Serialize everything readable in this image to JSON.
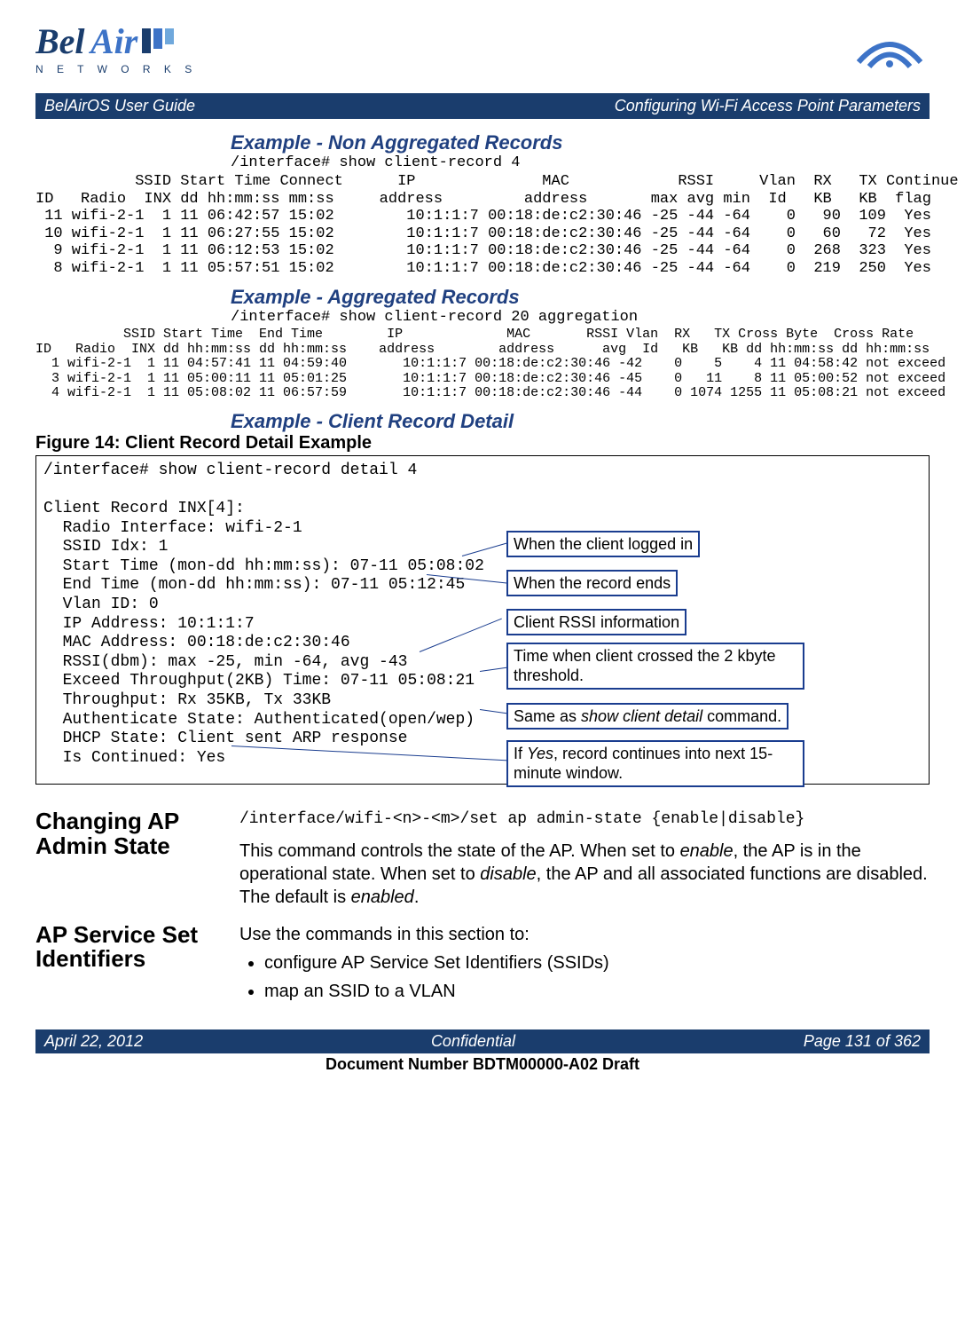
{
  "chart_data": {
    "type": "table",
    "tables": [
      {
        "name": "non_aggregated_records",
        "columns": [
          "ID",
          "Radio",
          "SSID INX",
          "Start Time dd",
          "Start Time hh:mm:ss",
          "Connect mm:ss",
          "IP address",
          "MAC address",
          "RSSI max",
          "RSSI avg",
          "RSSI min",
          "Vlan Id",
          "RX KB",
          "TX KB",
          "Continue flag"
        ],
        "rows": [
          [
            11,
            "wifi-2-1",
            1,
            11,
            "06:42:57",
            "15:02",
            "10:1:1:7",
            "00:18:de:c2:30:46",
            -25,
            -44,
            -64,
            0,
            90,
            109,
            "Yes"
          ],
          [
            10,
            "wifi-2-1",
            1,
            11,
            "06:27:55",
            "15:02",
            "10:1:1:7",
            "00:18:de:c2:30:46",
            -25,
            -44,
            -64,
            0,
            60,
            72,
            "Yes"
          ],
          [
            9,
            "wifi-2-1",
            1,
            11,
            "06:12:53",
            "15:02",
            "10:1:1:7",
            "00:18:de:c2:30:46",
            -25,
            -44,
            -64,
            0,
            268,
            323,
            "Yes"
          ],
          [
            8,
            "wifi-2-1",
            1,
            11,
            "05:57:51",
            "15:02",
            "10:1:1:7",
            "00:18:de:c2:30:46",
            -25,
            -44,
            -64,
            0,
            219,
            250,
            "Yes"
          ]
        ]
      },
      {
        "name": "aggregated_records",
        "columns": [
          "ID",
          "Radio",
          "SSID INX",
          "Start dd",
          "Start hh:mm:ss",
          "End dd",
          "End hh:mm:ss",
          "IP address",
          "MAC address",
          "RSSI avg",
          "Vlan Id",
          "RX KB",
          "TX KB",
          "Cross Byte dd",
          "Cross Byte hh:mm:ss",
          "Cross Rate dd",
          "Cross Rate hh:mm:ss"
        ],
        "rows": [
          [
            1,
            "wifi-2-1",
            1,
            11,
            "04:57:41",
            11,
            "04:59:40",
            "10:1:1:7",
            "00:18:de:c2:30:46",
            -42,
            0,
            5,
            4,
            11,
            "04:58:42",
            "not",
            "exceed"
          ],
          [
            3,
            "wifi-2-1",
            1,
            11,
            "05:00:11",
            11,
            "05:01:25",
            "10:1:1:7",
            "00:18:de:c2:30:46",
            -45,
            0,
            11,
            8,
            11,
            "05:00:52",
            "not",
            "exceed"
          ],
          [
            4,
            "wifi-2-1",
            1,
            11,
            "05:08:02",
            11,
            "06:57:59",
            "10:1:1:7",
            "00:18:de:c2:30:46",
            -44,
            0,
            1074,
            1255,
            11,
            "05:08:21",
            "not",
            "exceed"
          ]
        ]
      }
    ]
  },
  "header": {
    "guide_title": "BelAirOS User Guide",
    "page_topic": "Configuring Wi-Fi Access Point Parameters"
  },
  "logo": {
    "brand": "BelAir",
    "subtext": "N E T W O R K S"
  },
  "examples": {
    "non_agg": {
      "heading": "Example - Non Aggregated Records",
      "cmd": "/interface# show client-record 4",
      "text": "           SSID Start Time Connect      IP              MAC            RSSI     Vlan  RX   TX Continue\nID   Radio  INX dd hh:mm:ss mm:ss     address         address       max avg min  Id   KB   KB  flag\n 11 wifi-2-1  1 11 06:42:57 15:02        10:1:1:7 00:18:de:c2:30:46 -25 -44 -64    0   90  109  Yes\n 10 wifi-2-1  1 11 06:27:55 15:02        10:1:1:7 00:18:de:c2:30:46 -25 -44 -64    0   60   72  Yes\n  9 wifi-2-1  1 11 06:12:53 15:02        10:1:1:7 00:18:de:c2:30:46 -25 -44 -64    0  268  323  Yes\n  8 wifi-2-1  1 11 05:57:51 15:02        10:1:1:7 00:18:de:c2:30:46 -25 -44 -64    0  219  250  Yes"
    },
    "agg": {
      "heading": "Example - Aggregated Records",
      "cmd": "/interface# show client-record 20 aggregation",
      "text": "           SSID Start Time  End Time        IP             MAC       RSSI Vlan  RX   TX Cross Byte  Cross Rate\nID   Radio  INX dd hh:mm:ss dd hh:mm:ss    address        address      avg  Id   KB   KB dd hh:mm:ss dd hh:mm:ss\n  1 wifi-2-1  1 11 04:57:41 11 04:59:40       10:1:1:7 00:18:de:c2:30:46 -42    0    5    4 11 04:58:42 not exceed\n  3 wifi-2-1  1 11 05:00:11 11 05:01:25       10:1:1:7 00:18:de:c2:30:46 -45    0   11    8 11 05:00:52 not exceed\n  4 wifi-2-1  1 11 05:08:02 11 06:57:59       10:1:1:7 00:18:de:c2:30:46 -44    0 1074 1255 11 05:08:21 not exceed"
    },
    "detail": {
      "heading": "Example - Client Record Detail",
      "figure": "Figure 14: Client Record Detail Example",
      "text": "/interface# show client-record detail 4\n\nClient Record INX[4]:\n  Radio Interface: wifi-2-1\n  SSID Idx: 1\n  Start Time (mon-dd hh:mm:ss): 07-11 05:08:02\n  End Time (mon-dd hh:mm:ss): 07-11 05:12:45\n  Vlan ID: 0\n  IP Address: 10:1:1:7\n  MAC Address: 00:18:de:c2:30:46\n  RSSI(dbm): max -25, min -64, avg -43\n  Exceed Throughput(2KB) Time: 07-11 05:08:21\n  Throughput: Rx 35KB, Tx 33KB\n  Authenticate State: Authenticated(open/wep)\n  DHCP State: Client sent ARP response\n  Is Continued: Yes"
    }
  },
  "callouts": {
    "c1": "When the client logged in",
    "c2": "When the record ends",
    "c3": "Client RSSI information",
    "c4": "Time when client crossed the 2 kbyte threshold.",
    "c5_a": "Same as ",
    "c5_b": "show client detail",
    "c5_c": " command.",
    "c6_a": "If ",
    "c6_b": "Yes",
    "c6_c": ", record continues into next 15-minute window."
  },
  "sections": {
    "admin": {
      "title": "Changing AP Admin State",
      "cmd": "/interface/wifi-<n>-<m>/set ap admin-state {enable|disable}",
      "body_a": "This command controls the state of the AP. When set to ",
      "body_b": "enable",
      "body_c": ", the AP is in the operational state. When set to ",
      "body_d": "disable",
      "body_e": ", the AP and all associated functions are disabled. The default is ",
      "body_f": "enabled",
      "body_g": "."
    },
    "ssid": {
      "title": "AP Service Set Identifiers",
      "intro": "Use the commands in this section to:",
      "b1": "configure AP Service Set Identifiers (SSIDs)",
      "b2": "map an SSID to a VLAN"
    }
  },
  "footer": {
    "date": "April 22, 2012",
    "conf": "Confidential",
    "page": "Page 131 of 362",
    "docnum": "Document Number BDTM00000-A02 Draft"
  }
}
